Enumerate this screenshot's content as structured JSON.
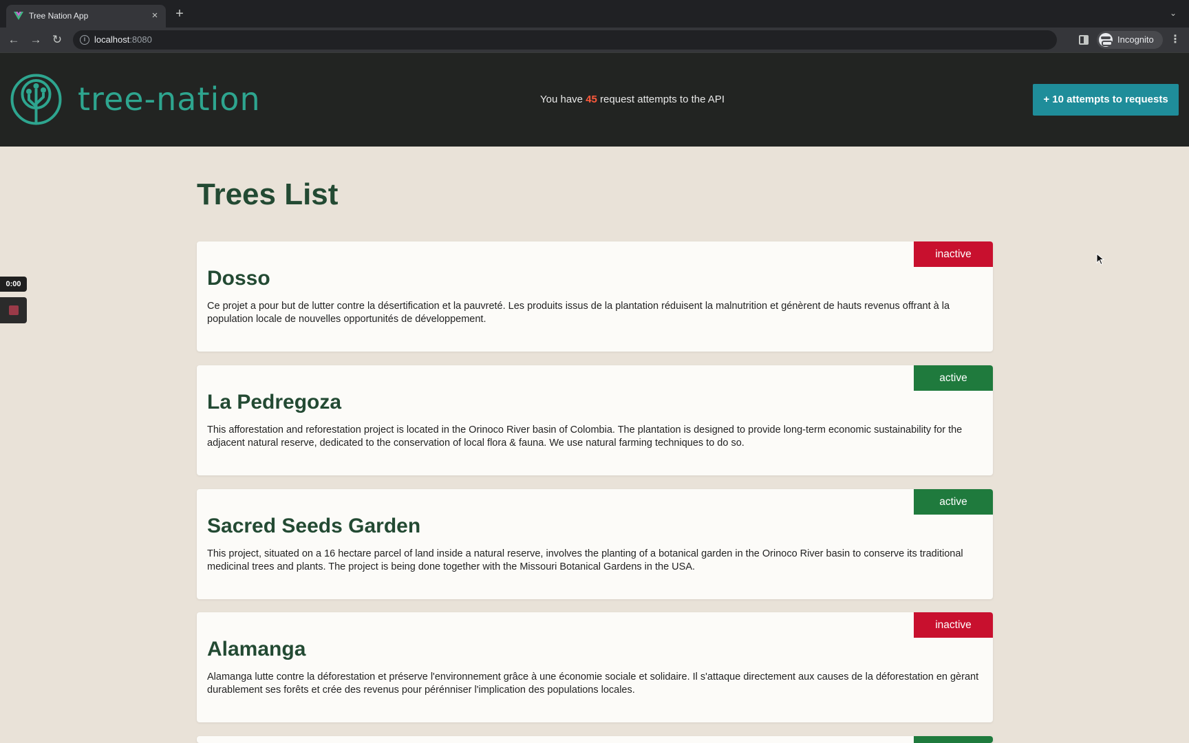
{
  "browser": {
    "tab_title": "Tree Nation App",
    "tab_close": "×",
    "new_tab": "+",
    "url_host": "localhost",
    "url_port": ":8080",
    "profile_label": "Incognito"
  },
  "header": {
    "logo_text": "tree-nation",
    "attempts_prefix": "You have ",
    "attempts_count": "45",
    "attempts_suffix": " request attempts to the API",
    "add_button_label": "+ 10 attempts to requests"
  },
  "recorder": {
    "time": "0:00"
  },
  "page": {
    "title": "Trees List"
  },
  "trees": [
    {
      "name": "Dosso",
      "status": "inactive",
      "description": "Ce projet a pour but de lutter contre la désertification et la pauvreté. Les produits issus de la plantation réduisent la malnutrition et génèrent de hauts revenus offrant à la population locale de nouvelles opportunités de développement."
    },
    {
      "name": "La Pedregoza",
      "status": "active",
      "description": "This afforestation and reforestation project is located in the Orinoco River basin of Colombia. The plantation is designed to provide long-term economic sustainability for the adjacent natural reserve, dedicated to the conservation of local flora & fauna. We use natural farming techniques to do so."
    },
    {
      "name": "Sacred Seeds Garden",
      "status": "active",
      "description": "This project, situated on a 16 hectare parcel of land inside a natural reserve, involves the planting of a botanical garden in the Orinoco River basin to conserve its traditional medicinal trees and plants. The project is being done together with the Missouri Botanical Gardens in the USA."
    },
    {
      "name": "Alamanga",
      "status": "inactive",
      "description": "Alamanga lutte contre la déforestation et préserve l'environnement grâce à une économie sociale et solidaire. Il s'attaque directement aux causes de la déforestation en gèrant durablement ses forêts et crée des revenus pour pérénniser l'implication des populations locales."
    }
  ],
  "colors": {
    "active": "#1f7a3d",
    "inactive": "#c8102e",
    "brand": "#2ea58f",
    "accent_button": "#1f8d9a"
  }
}
